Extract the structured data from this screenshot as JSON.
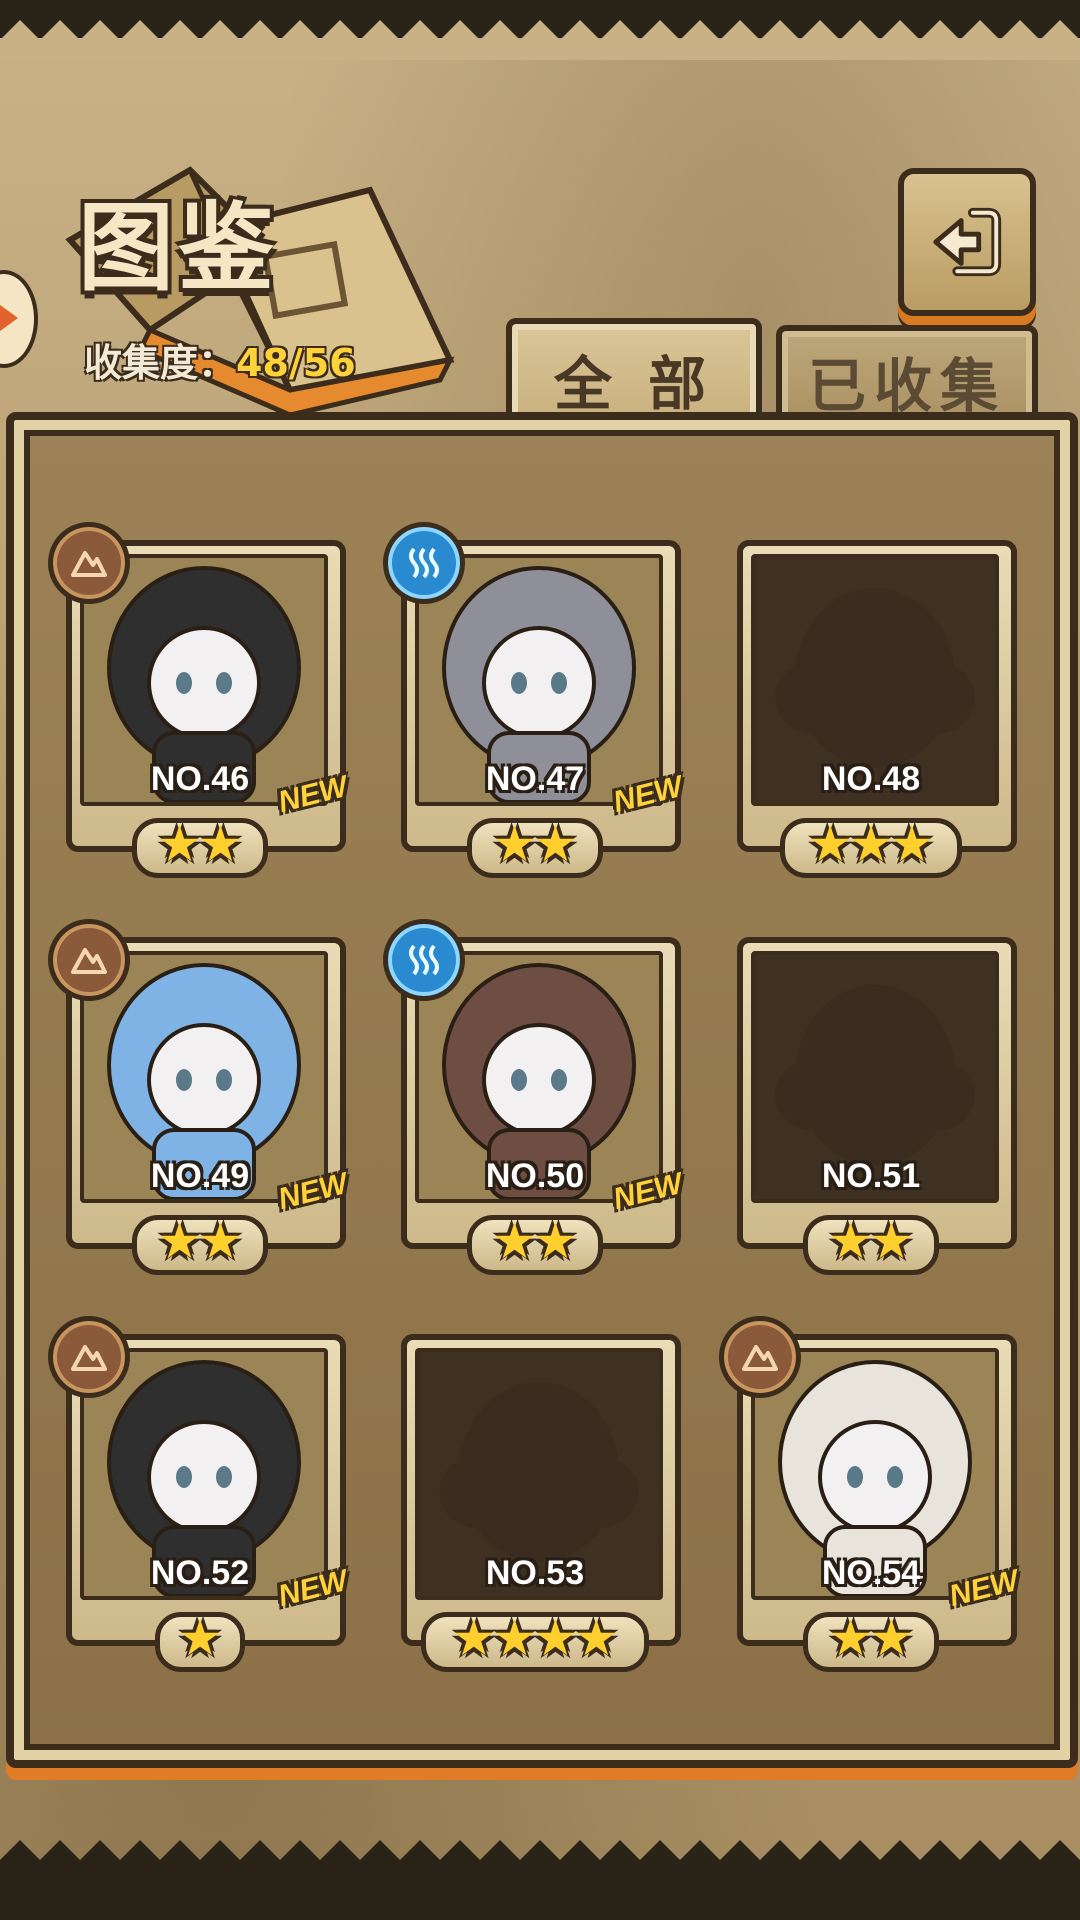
{
  "header": {
    "title": "图鉴",
    "collection_label": "收集度：",
    "collection_value": "48/56"
  },
  "tabs": [
    {
      "label": "全 部",
      "active": true
    },
    {
      "label": "已收集",
      "active": false
    }
  ],
  "icons": {
    "back": "back-arrow-icon",
    "side_nav": "side-arrow-icon",
    "earth_element": "earth-element-icon",
    "water_element": "water-element-icon"
  },
  "cards": [
    {
      "number": "NO.46",
      "stars": 2,
      "element": "earth",
      "new": true,
      "locked": false
    },
    {
      "number": "NO.47",
      "stars": 2,
      "element": "water",
      "new": true,
      "locked": false
    },
    {
      "number": "NO.48",
      "stars": 3,
      "element": null,
      "new": false,
      "locked": true
    },
    {
      "number": "NO.49",
      "stars": 2,
      "element": "earth",
      "new": true,
      "locked": false
    },
    {
      "number": "NO.50",
      "stars": 2,
      "element": "water",
      "new": true,
      "locked": false
    },
    {
      "number": "NO.51",
      "stars": 2,
      "element": null,
      "new": false,
      "locked": true
    },
    {
      "number": "NO.52",
      "stars": 1,
      "element": "earth",
      "new": true,
      "locked": false
    },
    {
      "number": "NO.53",
      "stars": 4,
      "element": null,
      "new": false,
      "locked": true
    },
    {
      "number": "NO.54",
      "stars": 2,
      "element": "earth",
      "new": true,
      "locked": false
    }
  ],
  "new_tag": "NEW",
  "colors": {
    "accent_orange": "#e17c26",
    "star_yellow": "#ffcf2e",
    "collection_yellow": "#ffd23a",
    "outline": "#3b2c1c"
  }
}
